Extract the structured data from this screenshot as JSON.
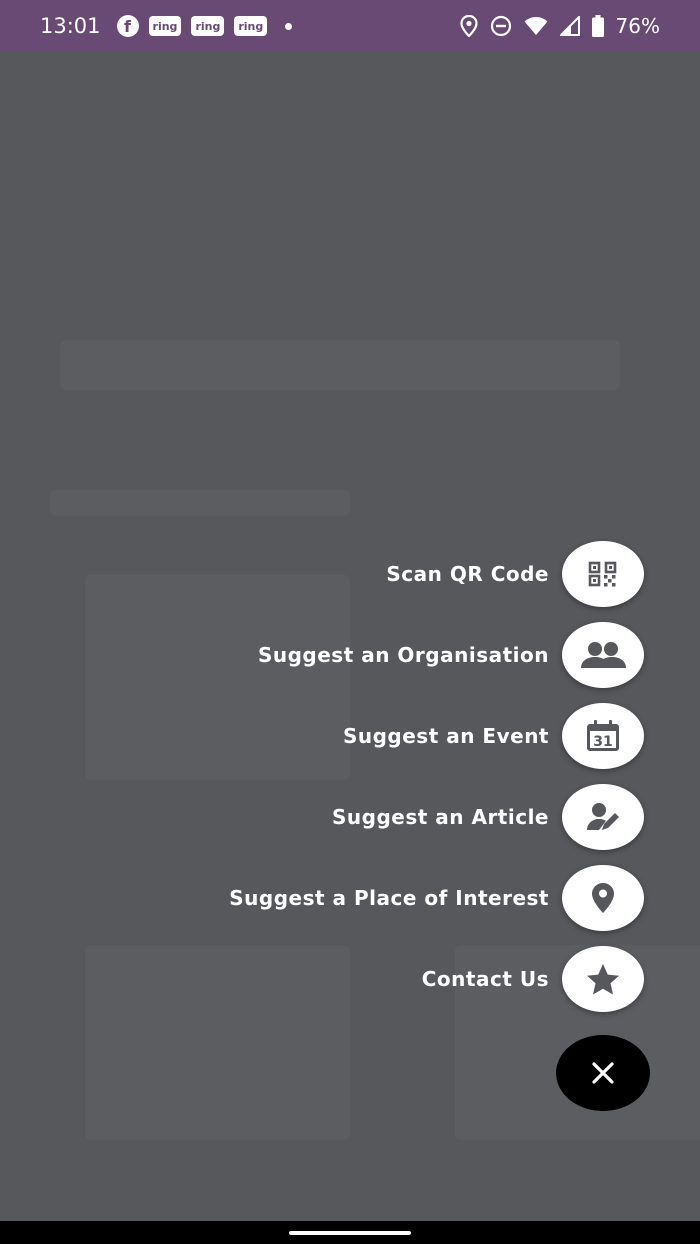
{
  "status_bar": {
    "time": "13:01",
    "fb_glyph": "f",
    "ring_labels": [
      "ring",
      "ring",
      "ring"
    ],
    "battery": "76%",
    "icons": [
      "facebook-icon",
      "ring-icon",
      "location-icon",
      "dnd-icon",
      "wifi-icon",
      "signal-icon",
      "battery-icon"
    ]
  },
  "fab_menu": {
    "items": [
      {
        "label": "Scan QR Code",
        "icon": "qr-code-icon"
      },
      {
        "label": "Suggest an Organisation",
        "icon": "people-icon"
      },
      {
        "label": "Suggest an Event",
        "icon": "calendar-icon"
      },
      {
        "label": "Suggest an Article",
        "icon": "person-edit-icon"
      },
      {
        "label": "Suggest a Place of Interest",
        "icon": "map-pin-icon"
      },
      {
        "label": "Contact Us",
        "icon": "star-icon"
      }
    ],
    "calendar_day": "31",
    "close_icon": "close-icon"
  },
  "colors": {
    "status_bar": "#694a74",
    "overlay": "#56585c",
    "fab_bg": "#ffffff",
    "icon": "#56585c",
    "close_bg": "#000000"
  }
}
